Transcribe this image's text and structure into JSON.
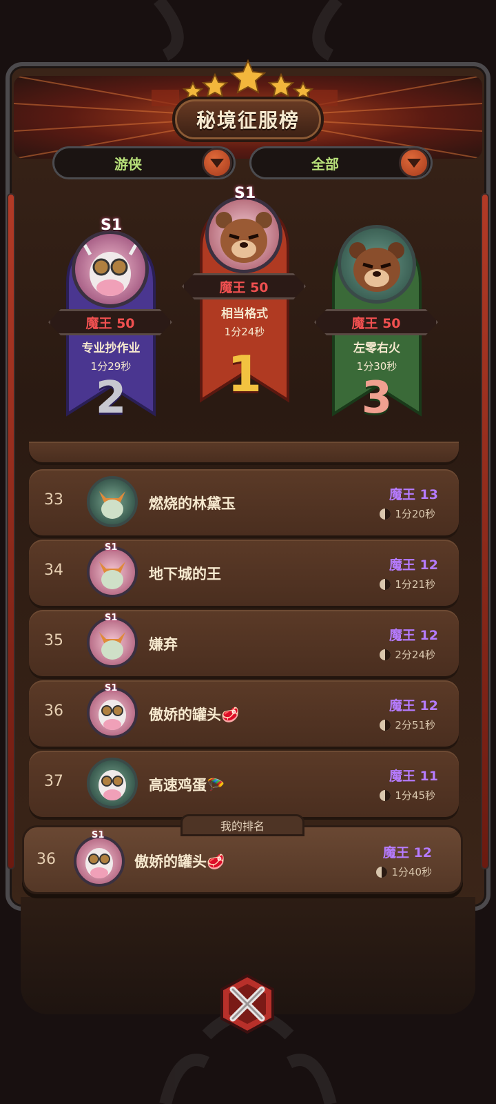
{
  "header": {
    "title": "秘境征服榜"
  },
  "filters": {
    "class_label": "游侠",
    "scope_label": "全部"
  },
  "podium": [
    {
      "place": "2",
      "season": "S1",
      "level": "魔王 50",
      "name": "专业抄作业",
      "time": "1分29秒",
      "avatar": "cow-icon"
    },
    {
      "place": "1",
      "season": "S1",
      "level": "魔王 50",
      "name": "相当格式",
      "time": "1分24秒",
      "avatar": "bear-icon"
    },
    {
      "place": "3",
      "season": "",
      "level": "魔王 50",
      "name": "左零右火",
      "time": "1分30秒",
      "avatar": "bear-icon"
    }
  ],
  "list": [
    {
      "rank": "33",
      "season": "",
      "name": "燃烧的林黛玉",
      "level": "魔王 13",
      "time": "1分20秒",
      "avatar": "fox-icon"
    },
    {
      "rank": "34",
      "season": "S1",
      "name": "地下城的王",
      "level": "魔王 12",
      "time": "1分21秒",
      "avatar": "fox-icon"
    },
    {
      "rank": "35",
      "season": "S1",
      "name": "嫌弃",
      "level": "魔王 12",
      "time": "2分24秒",
      "avatar": "fox-icon"
    },
    {
      "rank": "36",
      "season": "S1",
      "name": "傲娇的罐头🥩",
      "level": "魔王 12",
      "time": "2分51秒",
      "avatar": "cow-icon"
    },
    {
      "rank": "37",
      "season": "",
      "name": "高速鸡蛋🪂",
      "level": "魔王 11",
      "time": "1分45秒",
      "avatar": "cow-icon"
    }
  ],
  "my_rank": {
    "tab_label": "我的排名",
    "rank": "36",
    "season": "S1",
    "name": "傲娇的罐头🥩",
    "level": "魔王 12",
    "time": "1分40秒",
    "avatar": "cow-icon"
  },
  "colors": {
    "level_purple": "#b57bff",
    "level_red": "#f05050",
    "filter_green": "#b8e07a"
  }
}
